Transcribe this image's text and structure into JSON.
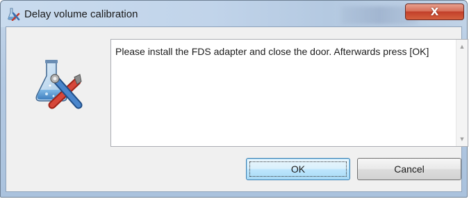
{
  "window": {
    "title": "Delay volume calibration",
    "close_glyph": "X"
  },
  "message": {
    "text": "Please install the FDS adapter and close the door. Afterwards press [OK]"
  },
  "scrollbar": {
    "up_glyph": "▲",
    "down_glyph": "▼"
  },
  "buttons": {
    "ok_label": "OK",
    "cancel_label": "Cancel"
  },
  "icons": {
    "title_icon": "calibration-tools-icon",
    "app_icon": "calibration-tools-icon"
  },
  "colors": {
    "titlebar": "#c1d4ea",
    "close_button": "#c2402a",
    "ok_button_border": "#3c7fb1"
  }
}
